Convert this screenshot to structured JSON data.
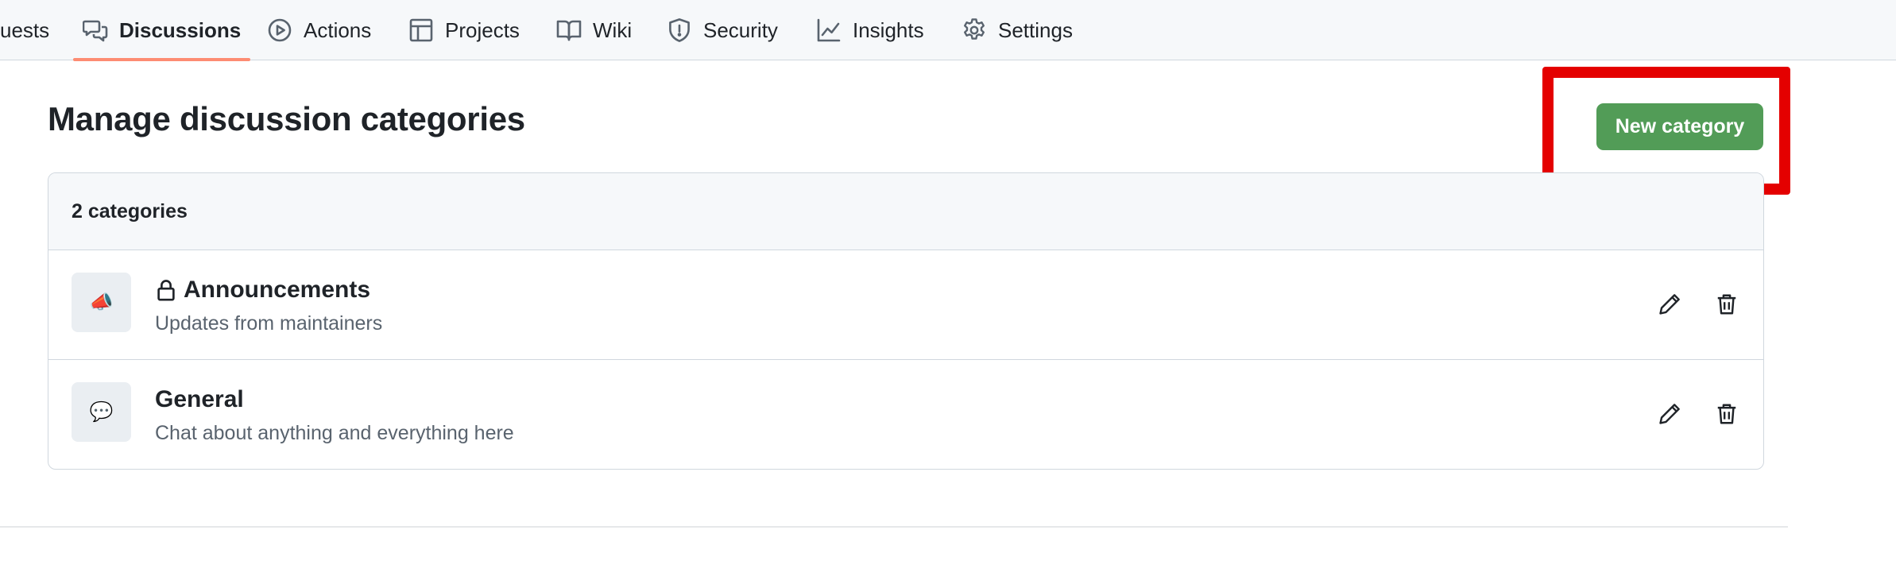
{
  "nav": {
    "tabs": [
      {
        "label": "uests",
        "icon": "pull-request-icon"
      },
      {
        "label": "Discussions",
        "icon": "comment-discussion-icon",
        "selected": true
      },
      {
        "label": "Actions",
        "icon": "play-icon"
      },
      {
        "label": "Projects",
        "icon": "table-icon"
      },
      {
        "label": "Wiki",
        "icon": "book-icon"
      },
      {
        "label": "Security",
        "icon": "shield-icon"
      },
      {
        "label": "Insights",
        "icon": "graph-icon"
      },
      {
        "label": "Settings",
        "icon": "gear-icon"
      }
    ]
  },
  "page": {
    "title": "Manage discussion categories",
    "new_button": "New category"
  },
  "categories": {
    "count_label": "2 categories",
    "items": [
      {
        "emoji": "📣",
        "name": "Announcements",
        "description": "Updates from maintainers",
        "locked": true
      },
      {
        "emoji": "💬",
        "name": "General",
        "description": "Chat about anything and everything here",
        "locked": false
      }
    ]
  },
  "colors": {
    "primary_button": "#529c57",
    "selected_tab_underline": "#fd8c73",
    "highlight_box": "#e40000"
  }
}
